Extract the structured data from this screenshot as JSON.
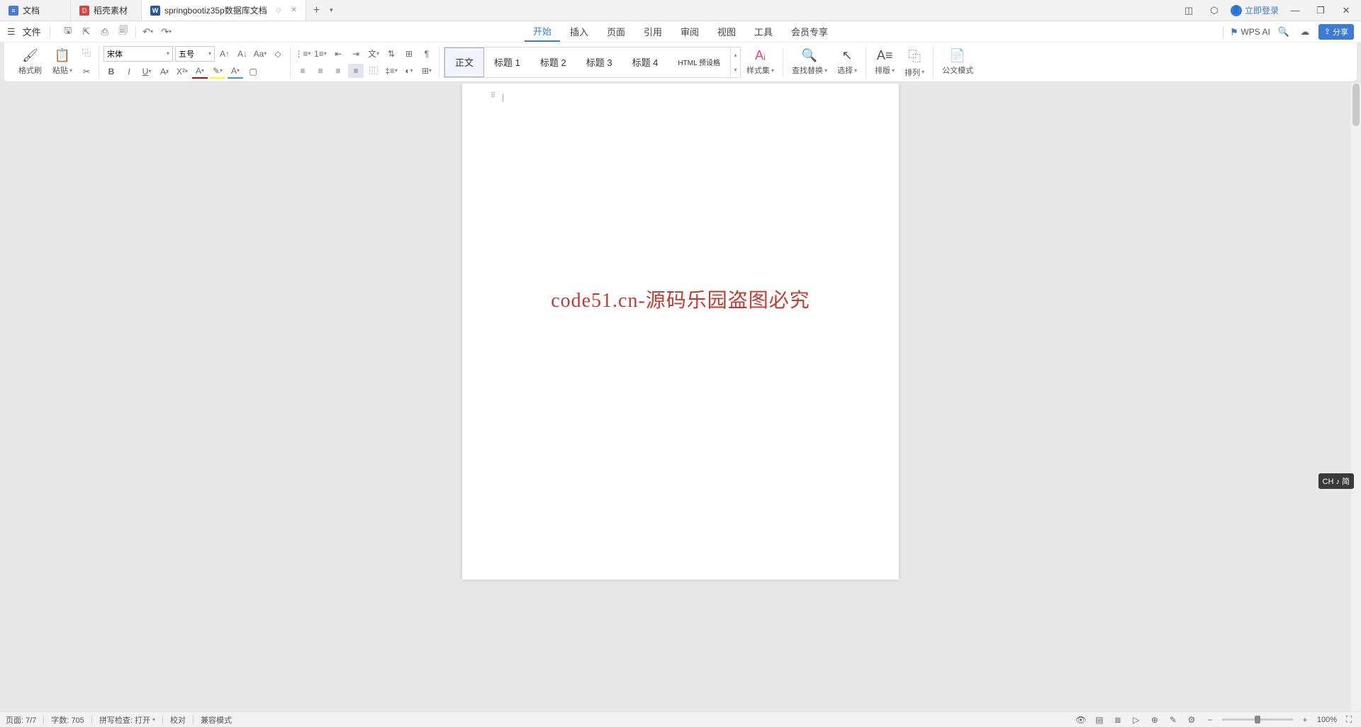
{
  "watermark": "code51.cn",
  "tabs": [
    {
      "label": "文档",
      "iconClass": "blue",
      "iconChar": "≡"
    },
    {
      "label": "稻壳素材",
      "iconClass": "red",
      "iconChar": "D"
    },
    {
      "label": "springbootiz35p数据库文档",
      "iconClass": "word",
      "iconChar": "W",
      "active": true
    }
  ],
  "titlebar": {
    "login": "立即登录"
  },
  "menubar": {
    "file": "文件",
    "menus": [
      "开始",
      "插入",
      "页面",
      "引用",
      "审阅",
      "视图",
      "工具",
      "会员专享"
    ],
    "activeMenu": "开始",
    "wpsai": "WPS AI",
    "share": "分享"
  },
  "ribbon": {
    "format_brush": "格式刷",
    "paste": "粘贴",
    "font_name": "宋体",
    "font_size": "五号",
    "styles": {
      "body": "正文",
      "h1": "标题 1",
      "h2": "标题 2",
      "h3": "标题 3",
      "h4": "标题 4",
      "html": "HTML 预设格",
      "styleset": "样式集",
      "findreplace": "查找替换",
      "select": "选择",
      "layout": "排版",
      "arrange": "排列",
      "doc_mode": "公文模式"
    }
  },
  "document": {
    "content": "code51.cn-源码乐园盗图必究"
  },
  "statusbar": {
    "page": "页面: 7/7",
    "words": "字数: 705",
    "spellcheck": "拼写检查: 打开",
    "proof": "校对",
    "compat": "兼容模式",
    "zoom": "100%"
  },
  "ime": "CH ♪ 简"
}
